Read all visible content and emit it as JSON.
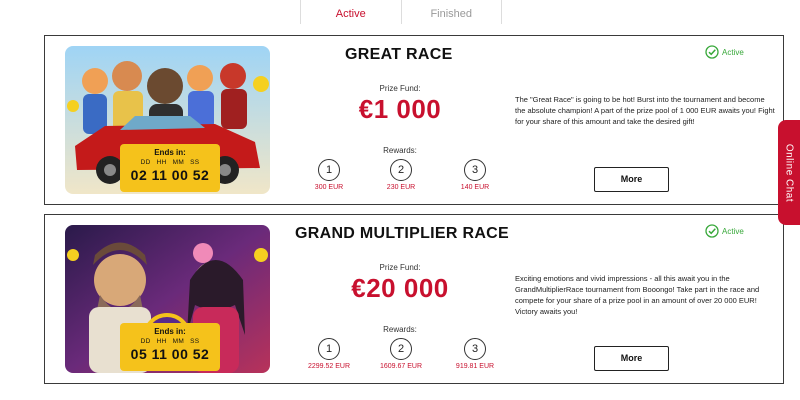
{
  "tabs": [
    {
      "label": "Active",
      "active": true
    },
    {
      "label": "Finished",
      "active": false
    }
  ],
  "tournaments": [
    {
      "title": "GREAT RACE",
      "status": "Active",
      "prize_label": "Prize Fund:",
      "prize_value": "€1 000",
      "rewards_label": "Rewards:",
      "rewards": [
        {
          "place": "1",
          "amount": "300 EUR"
        },
        {
          "place": "2",
          "amount": "230 EUR"
        },
        {
          "place": "3",
          "amount": "140 EUR"
        }
      ],
      "description": "The \"Great Race\" is going to be hot! Burst into the tournament and become the absolute champion! A part of the prize pool of 1 000 EUR awaits you! Fight for your share of this amount and take the desired gift!",
      "timer": {
        "label": "Ends in:",
        "units": [
          "DD",
          "HH",
          "MM",
          "SS"
        ],
        "value": "02 11 00 52"
      },
      "button": "More"
    },
    {
      "title": "GRAND MULTIPLIER RACE",
      "status": "Active",
      "prize_label": "Prize Fund:",
      "prize_value": "€20 000",
      "rewards_label": "Rewards:",
      "rewards": [
        {
          "place": "1",
          "amount": "2299.52 EUR"
        },
        {
          "place": "2",
          "amount": "1609.67 EUR"
        },
        {
          "place": "3",
          "amount": "919.81 EUR"
        }
      ],
      "description": "Exciting emotions and vivid impressions - all this await you in the GrandMultiplierRace tournament from Booongo! Take part in the race and compete for your share of a prize pool in an amount of over 20 000 EUR! Victory awaits you!",
      "timer": {
        "label": "Ends in:",
        "units": [
          "DD",
          "HH",
          "MM",
          "SS"
        ],
        "value": "05 11 00 52"
      },
      "button": "More"
    }
  ],
  "online_chat": "Online Chat",
  "colors": {
    "accent": "#c8102e",
    "status": "#38a83a",
    "timer_bg": "#f5c21b"
  },
  "icons": {
    "status": "check-circle-icon"
  }
}
